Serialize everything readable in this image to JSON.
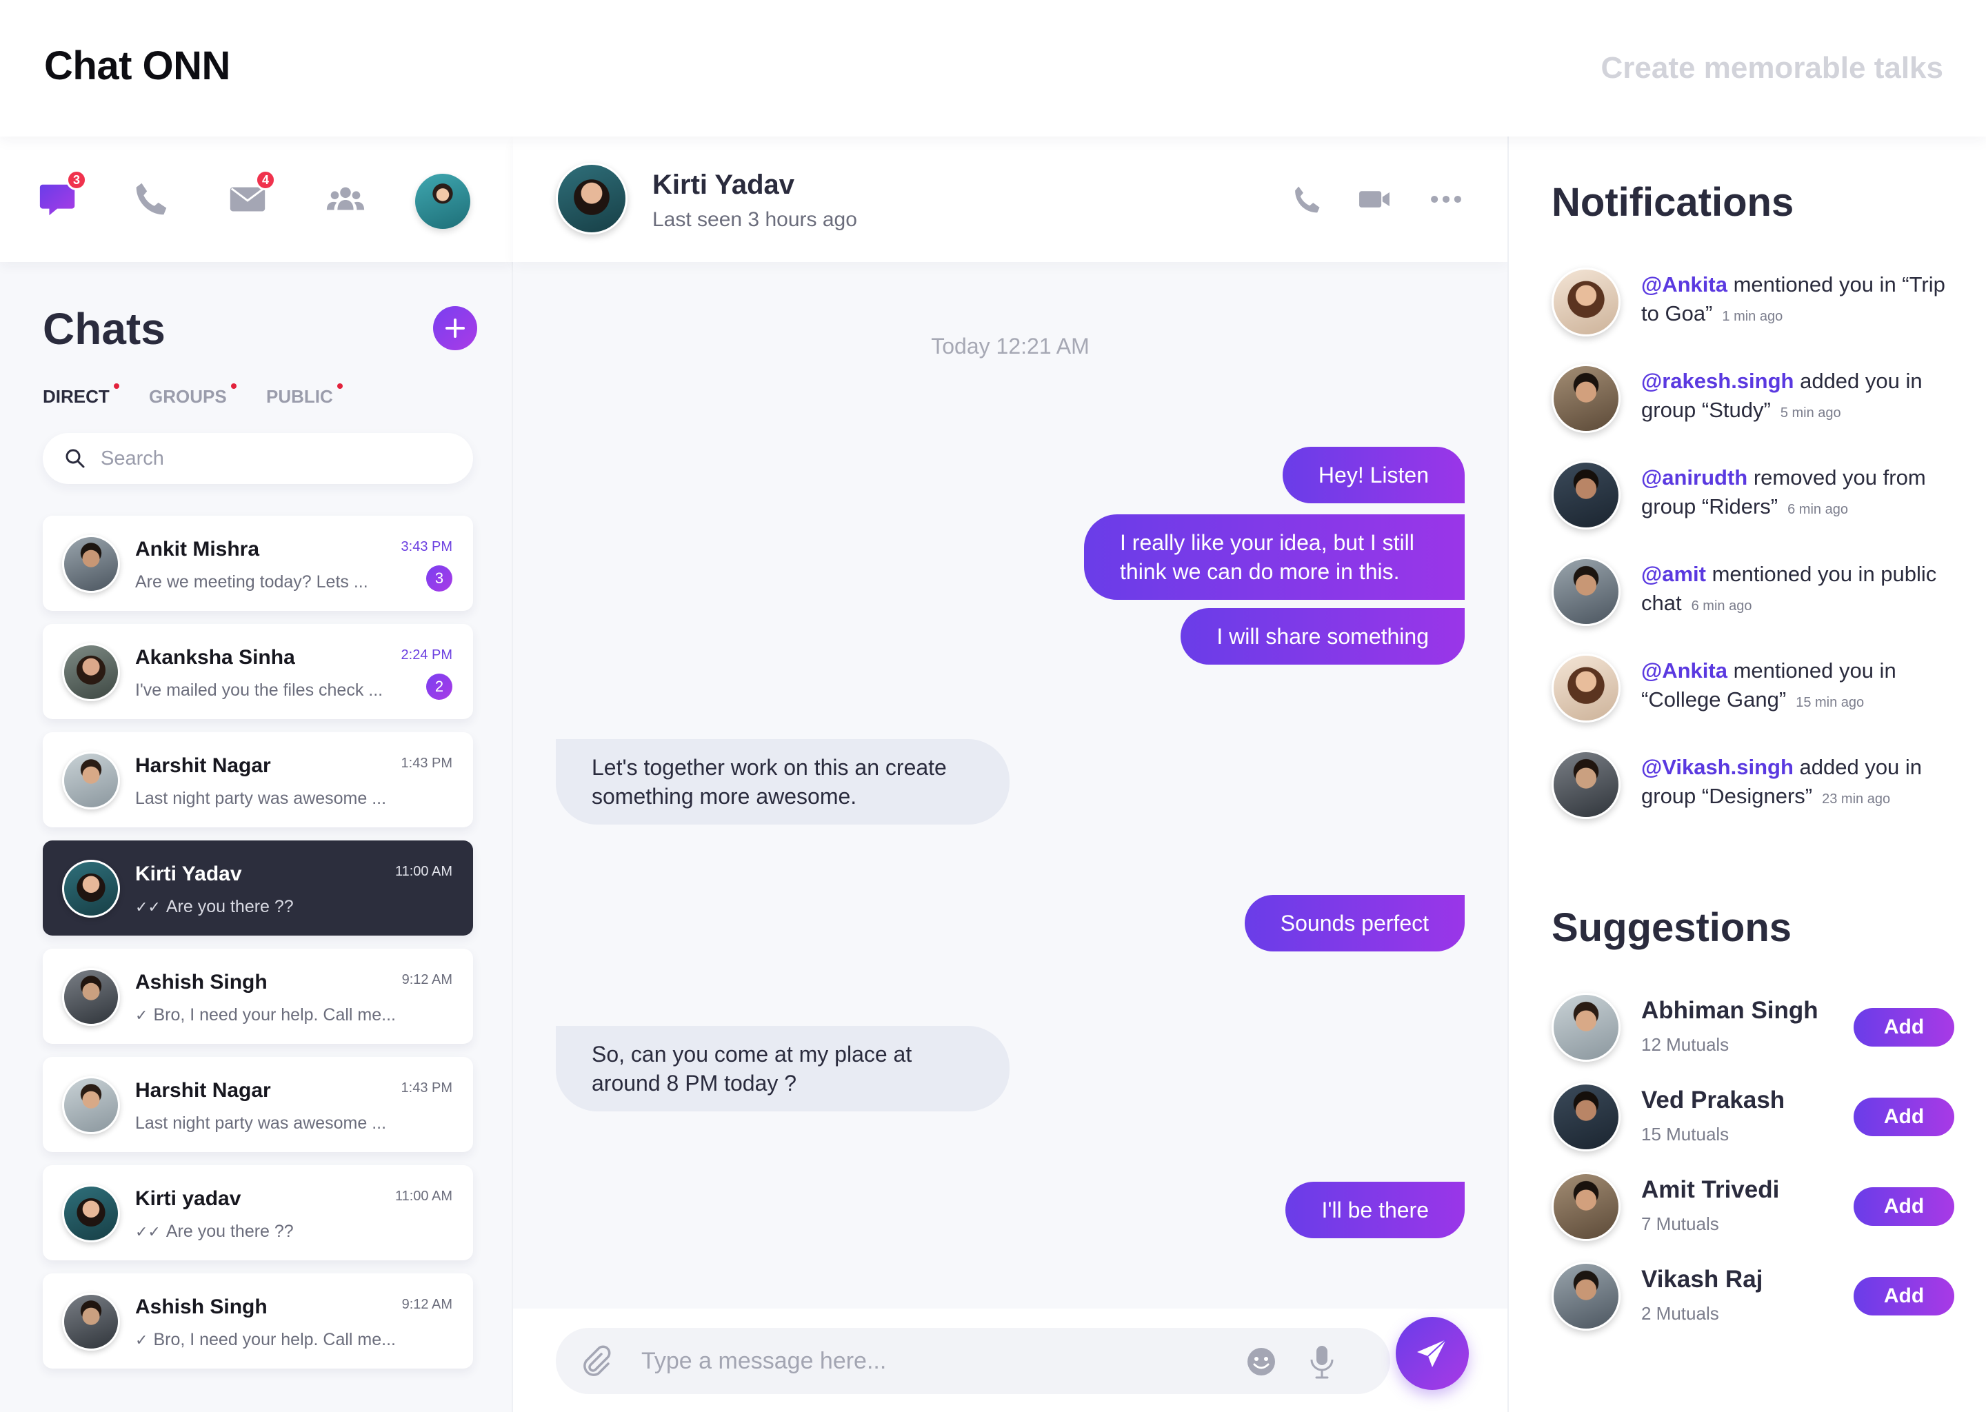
{
  "app": {
    "title": "Chat ONN",
    "tagline": "Create memorable talks"
  },
  "colors": {
    "accent": "#7a3ff0",
    "accent_end": "#a93be6",
    "active_chat": "#2c2e3d",
    "badge": "#f0324d",
    "incoming_bubble": "#e8ebf3"
  },
  "nav": {
    "items": [
      {
        "icon": "chat-bubble-icon",
        "badge": "3"
      },
      {
        "icon": "phone-icon",
        "badge": ""
      },
      {
        "icon": "mail-icon",
        "badge": "4"
      },
      {
        "icon": "group-icon",
        "badge": ""
      },
      {
        "icon": "profile-avatar",
        "badge": ""
      }
    ]
  },
  "sidebar": {
    "heading": "Chats",
    "tabs": [
      {
        "label": "DIRECT",
        "active": true
      },
      {
        "label": "GROUPS",
        "active": false
      },
      {
        "label": "PUBLIC",
        "active": false
      }
    ],
    "search_placeholder": "Search",
    "chats": [
      {
        "name": "Ankit Mishra",
        "preview": "Are we meeting today? Lets ...",
        "time": "3:43 PM",
        "unread": "3",
        "read_mark": "",
        "active": false
      },
      {
        "name": "Akanksha Sinha",
        "preview": "I've mailed you the files check ...",
        "time": "2:24 PM",
        "unread": "2",
        "read_mark": "",
        "active": false
      },
      {
        "name": "Harshit Nagar",
        "preview": "Last night party was awesome ...",
        "time": "1:43 PM",
        "unread": "",
        "read_mark": "",
        "active": false
      },
      {
        "name": "Kirti Yadav",
        "preview": "Are you there ??",
        "time": "11:00 AM",
        "unread": "",
        "read_mark": "double-check",
        "active": true
      },
      {
        "name": "Ashish Singh",
        "preview": "Bro, I need your help. Call me...",
        "time": "9:12 AM",
        "unread": "",
        "read_mark": "check",
        "active": false
      },
      {
        "name": "Harshit Nagar",
        "preview": "Last night party was awesome ...",
        "time": "1:43 PM",
        "unread": "",
        "read_mark": "",
        "active": false
      },
      {
        "name": "Kirti yadav",
        "preview": "Are you there ??",
        "time": "11:00 AM",
        "unread": "",
        "read_mark": "double-check",
        "active": false
      },
      {
        "name": "Ashish Singh",
        "preview": "Bro, I need your help. Call me...",
        "time": "9:12 AM",
        "unread": "",
        "read_mark": "check",
        "active": false
      }
    ]
  },
  "conversation": {
    "contact_name": "Kirti Yadav",
    "status": "Last seen 3 hours ago",
    "day_stamp": "Today 12:21 AM",
    "messages": [
      {
        "direction": "out",
        "text": "Hey! Listen"
      },
      {
        "direction": "out",
        "text": "I really like your idea, but I still think we can do more in this."
      },
      {
        "direction": "out",
        "text": "I will share something"
      },
      {
        "direction": "in",
        "text": "Let's together work on this an create something more awesome."
      },
      {
        "direction": "out",
        "text": "Sounds perfect"
      },
      {
        "direction": "in",
        "text": "So, can you come at my place at around 8 PM today ?"
      },
      {
        "direction": "out",
        "text": "I'll be there"
      }
    ],
    "composer_placeholder": "Type a message here..."
  },
  "notifications": {
    "heading": "Notifications",
    "items": [
      {
        "handle": "@Ankita",
        "text": " mentioned you in “Trip to Goa”",
        "ago": "1 min ago"
      },
      {
        "handle": "@rakesh.singh",
        "text": " added you in group “Study”",
        "ago": "5 min ago"
      },
      {
        "handle": "@anirudth",
        "text": " removed you from group “Riders”",
        "ago": "6 min ago"
      },
      {
        "handle": "@amit",
        "text": " mentioned you in public chat",
        "ago": "6 min ago"
      },
      {
        "handle": "@Ankita",
        "text": " mentioned you in “College Gang”",
        "ago": "15 min ago"
      },
      {
        "handle": "@Vikash.singh",
        "text": " added you in group “Designers”",
        "ago": "23 min ago"
      }
    ]
  },
  "suggestions": {
    "heading": "Suggestions",
    "add_label": "Add",
    "items": [
      {
        "name": "Abhiman Singh",
        "mutuals": "12 Mutuals"
      },
      {
        "name": "Ved Prakash",
        "mutuals": "15 Mutuals"
      },
      {
        "name": "Amit Trivedi",
        "mutuals": "7 Mutuals"
      },
      {
        "name": "Vikash Raj",
        "mutuals": "2 Mutuals"
      }
    ]
  }
}
